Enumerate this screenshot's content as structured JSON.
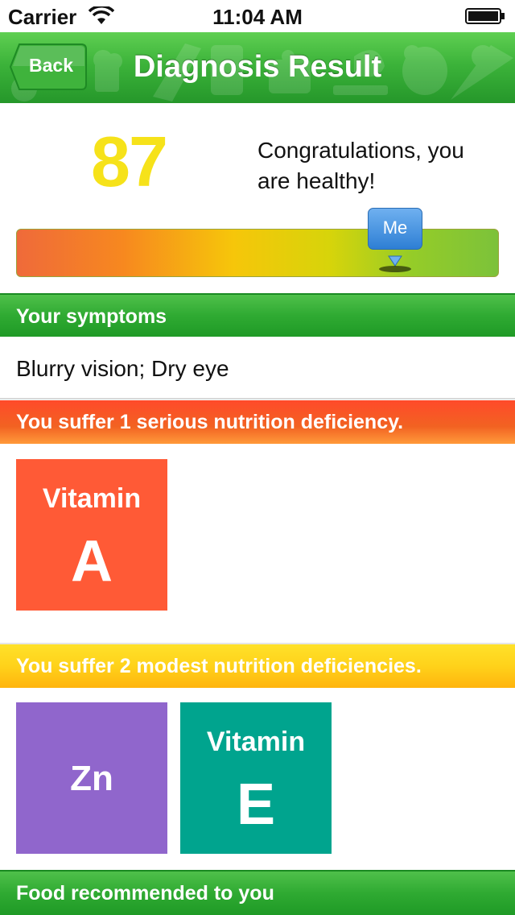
{
  "status_bar": {
    "carrier": "Carrier",
    "time": "11:04 AM"
  },
  "nav": {
    "back_label": "Back",
    "title": "Diagnosis Result"
  },
  "score": {
    "value": "87",
    "message": "Congratulations, you are healthy!",
    "marker_label": "Me",
    "marker_fraction": 0.785,
    "gradient_colors": [
      "#ef6a3a",
      "#f6c60a",
      "#7cc23a"
    ]
  },
  "symptoms": {
    "header": "Your symptoms",
    "text": "Blurry vision; Dry eye"
  },
  "serious": {
    "header": "You suffer 1 serious nutrition deficiency.",
    "tiles": [
      {
        "top": "Vitamin",
        "big": "A",
        "color": "#ff5a36"
      }
    ]
  },
  "modest": {
    "header": "You suffer 2 modest nutrition deficiencies.",
    "tiles": [
      {
        "top": "",
        "big": "Zn",
        "color": "#9066cc"
      },
      {
        "top": "Vitamin",
        "big": "E",
        "color": "#00a48e"
      }
    ]
  },
  "food": {
    "header": "Food recommended to you"
  },
  "colors": {
    "nav_green": "#3cb33a",
    "score_yellow": "#f6e21a",
    "marker_blue": "#2e7fd4"
  },
  "icons": [
    "wifi-icon",
    "battery-icon",
    "back-arrow-icon",
    "food-pattern-decoration"
  ]
}
